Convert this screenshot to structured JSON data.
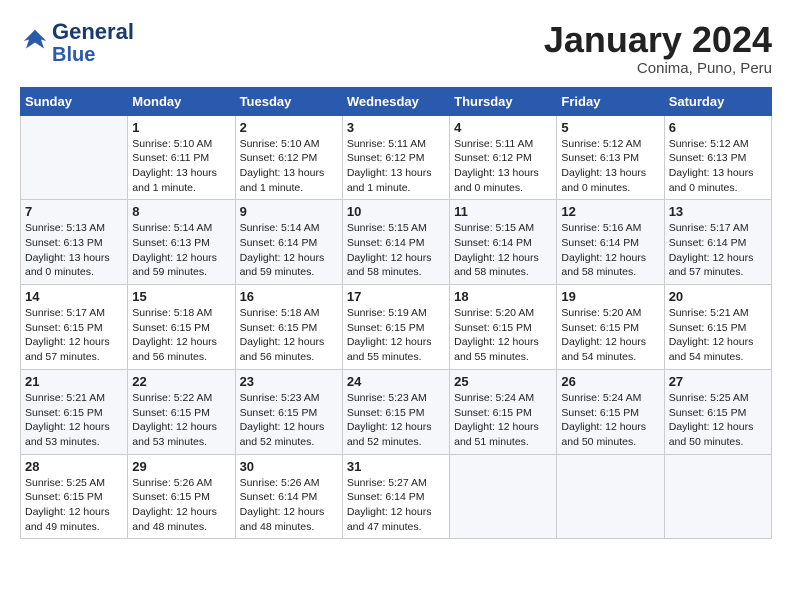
{
  "header": {
    "logo_line1": "General",
    "logo_line2": "Blue",
    "month": "January 2024",
    "location": "Conima, Puno, Peru"
  },
  "days_of_week": [
    "Sunday",
    "Monday",
    "Tuesday",
    "Wednesday",
    "Thursday",
    "Friday",
    "Saturday"
  ],
  "weeks": [
    [
      {
        "day": "",
        "info": ""
      },
      {
        "day": "1",
        "info": "Sunrise: 5:10 AM\nSunset: 6:11 PM\nDaylight: 13 hours\nand 1 minute."
      },
      {
        "day": "2",
        "info": "Sunrise: 5:10 AM\nSunset: 6:12 PM\nDaylight: 13 hours\nand 1 minute."
      },
      {
        "day": "3",
        "info": "Sunrise: 5:11 AM\nSunset: 6:12 PM\nDaylight: 13 hours\nand 1 minute."
      },
      {
        "day": "4",
        "info": "Sunrise: 5:11 AM\nSunset: 6:12 PM\nDaylight: 13 hours\nand 0 minutes."
      },
      {
        "day": "5",
        "info": "Sunrise: 5:12 AM\nSunset: 6:13 PM\nDaylight: 13 hours\nand 0 minutes."
      },
      {
        "day": "6",
        "info": "Sunrise: 5:12 AM\nSunset: 6:13 PM\nDaylight: 13 hours\nand 0 minutes."
      }
    ],
    [
      {
        "day": "7",
        "info": "Sunrise: 5:13 AM\nSunset: 6:13 PM\nDaylight: 13 hours\nand 0 minutes."
      },
      {
        "day": "8",
        "info": "Sunrise: 5:14 AM\nSunset: 6:13 PM\nDaylight: 12 hours\nand 59 minutes."
      },
      {
        "day": "9",
        "info": "Sunrise: 5:14 AM\nSunset: 6:14 PM\nDaylight: 12 hours\nand 59 minutes."
      },
      {
        "day": "10",
        "info": "Sunrise: 5:15 AM\nSunset: 6:14 PM\nDaylight: 12 hours\nand 58 minutes."
      },
      {
        "day": "11",
        "info": "Sunrise: 5:15 AM\nSunset: 6:14 PM\nDaylight: 12 hours\nand 58 minutes."
      },
      {
        "day": "12",
        "info": "Sunrise: 5:16 AM\nSunset: 6:14 PM\nDaylight: 12 hours\nand 58 minutes."
      },
      {
        "day": "13",
        "info": "Sunrise: 5:17 AM\nSunset: 6:14 PM\nDaylight: 12 hours\nand 57 minutes."
      }
    ],
    [
      {
        "day": "14",
        "info": "Sunrise: 5:17 AM\nSunset: 6:15 PM\nDaylight: 12 hours\nand 57 minutes."
      },
      {
        "day": "15",
        "info": "Sunrise: 5:18 AM\nSunset: 6:15 PM\nDaylight: 12 hours\nand 56 minutes."
      },
      {
        "day": "16",
        "info": "Sunrise: 5:18 AM\nSunset: 6:15 PM\nDaylight: 12 hours\nand 56 minutes."
      },
      {
        "day": "17",
        "info": "Sunrise: 5:19 AM\nSunset: 6:15 PM\nDaylight: 12 hours\nand 55 minutes."
      },
      {
        "day": "18",
        "info": "Sunrise: 5:20 AM\nSunset: 6:15 PM\nDaylight: 12 hours\nand 55 minutes."
      },
      {
        "day": "19",
        "info": "Sunrise: 5:20 AM\nSunset: 6:15 PM\nDaylight: 12 hours\nand 54 minutes."
      },
      {
        "day": "20",
        "info": "Sunrise: 5:21 AM\nSunset: 6:15 PM\nDaylight: 12 hours\nand 54 minutes."
      }
    ],
    [
      {
        "day": "21",
        "info": "Sunrise: 5:21 AM\nSunset: 6:15 PM\nDaylight: 12 hours\nand 53 minutes."
      },
      {
        "day": "22",
        "info": "Sunrise: 5:22 AM\nSunset: 6:15 PM\nDaylight: 12 hours\nand 53 minutes."
      },
      {
        "day": "23",
        "info": "Sunrise: 5:23 AM\nSunset: 6:15 PM\nDaylight: 12 hours\nand 52 minutes."
      },
      {
        "day": "24",
        "info": "Sunrise: 5:23 AM\nSunset: 6:15 PM\nDaylight: 12 hours\nand 52 minutes."
      },
      {
        "day": "25",
        "info": "Sunrise: 5:24 AM\nSunset: 6:15 PM\nDaylight: 12 hours\nand 51 minutes."
      },
      {
        "day": "26",
        "info": "Sunrise: 5:24 AM\nSunset: 6:15 PM\nDaylight: 12 hours\nand 50 minutes."
      },
      {
        "day": "27",
        "info": "Sunrise: 5:25 AM\nSunset: 6:15 PM\nDaylight: 12 hours\nand 50 minutes."
      }
    ],
    [
      {
        "day": "28",
        "info": "Sunrise: 5:25 AM\nSunset: 6:15 PM\nDaylight: 12 hours\nand 49 minutes."
      },
      {
        "day": "29",
        "info": "Sunrise: 5:26 AM\nSunset: 6:15 PM\nDaylight: 12 hours\nand 48 minutes."
      },
      {
        "day": "30",
        "info": "Sunrise: 5:26 AM\nSunset: 6:14 PM\nDaylight: 12 hours\nand 48 minutes."
      },
      {
        "day": "31",
        "info": "Sunrise: 5:27 AM\nSunset: 6:14 PM\nDaylight: 12 hours\nand 47 minutes."
      },
      {
        "day": "",
        "info": ""
      },
      {
        "day": "",
        "info": ""
      },
      {
        "day": "",
        "info": ""
      }
    ]
  ]
}
